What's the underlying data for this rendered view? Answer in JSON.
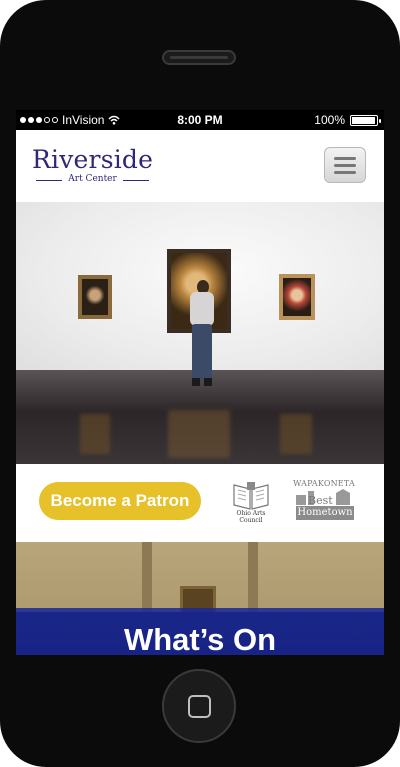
{
  "status_bar": {
    "carrier": "InVision",
    "time": "8:00 PM",
    "battery": "100%",
    "battery_level": 1.0
  },
  "header": {
    "logo_title": "Riverside",
    "logo_subtitle": "Art Center"
  },
  "patron": {
    "button_label": "Become a Patron"
  },
  "sponsors": {
    "oac_label": "Ohio Arts Council",
    "wapa_top": "WAPAKONETA",
    "wapa_best": "Best",
    "wapa_hometown": "Hometown"
  },
  "section": {
    "title": "What’s On"
  },
  "colors": {
    "brand_purple": "#2f2876",
    "patron_yellow": "#e6c12a",
    "banner_blue": "#1a2896"
  }
}
